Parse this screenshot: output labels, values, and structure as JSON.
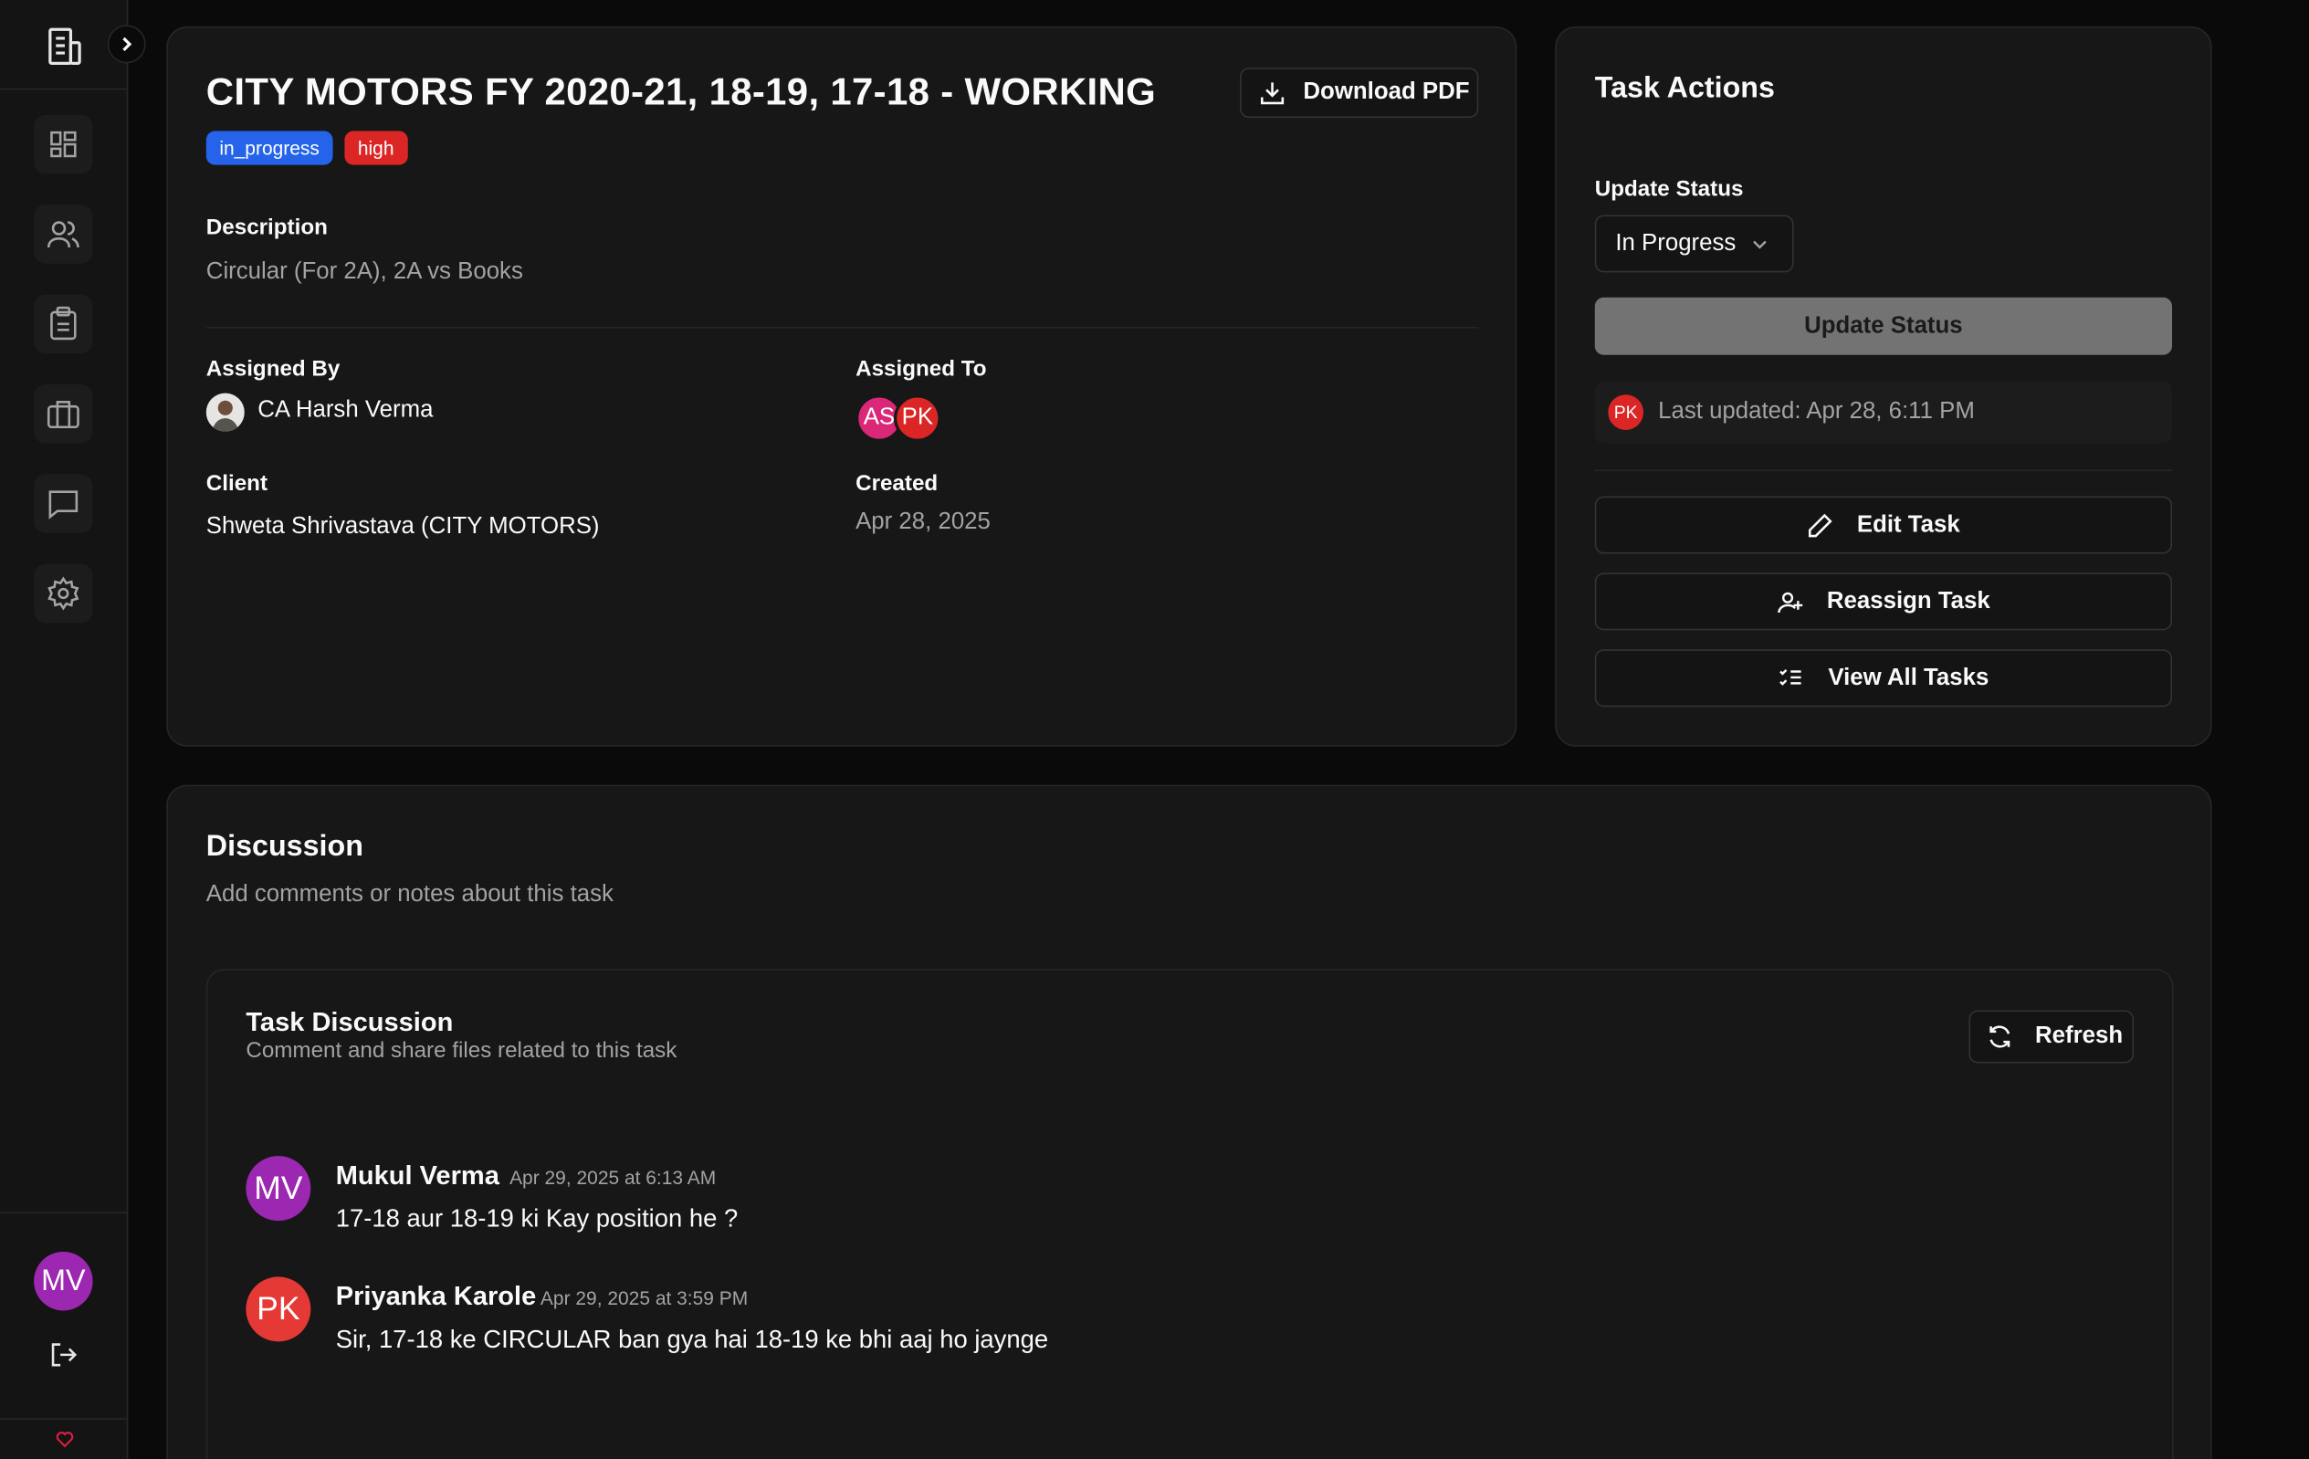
{
  "sidebar": {
    "nav": [
      "dashboard-icon",
      "users-icon",
      "clipboard-icon",
      "briefcase-icon",
      "message-icon",
      "settings-icon"
    ],
    "user_initials": "MV"
  },
  "task": {
    "title": "CITY MOTORS FY 2020-21, 18-19, 17-18 - WORKING",
    "status_badge": "in_progress",
    "priority_badge": "high",
    "download_label": "Download PDF",
    "description_label": "Description",
    "description": "Circular (For 2A), 2A vs Books",
    "assigned_by_label": "Assigned By",
    "assigned_by": "CA Harsh Verma",
    "assigned_to_label": "Assigned To",
    "assignees": [
      "AS",
      "PK"
    ],
    "client_label": "Client",
    "client": "Shweta Shrivastava (CITY MOTORS)",
    "created_label": "Created",
    "created": "Apr 28, 2025"
  },
  "actions": {
    "title": "Task Actions",
    "update_status_label": "Update Status",
    "status_value": "In Progress",
    "update_button": "Update Status",
    "last_updated_initials": "PK",
    "last_updated": "Last updated: Apr 28, 6:11 PM",
    "edit": "Edit Task",
    "reassign": "Reassign Task",
    "view_all": "View All Tasks"
  },
  "discussion": {
    "title": "Discussion",
    "subtitle": "Add comments or notes about this task",
    "inner_title": "Task Discussion",
    "inner_subtitle": "Comment and share files related to this task",
    "refresh": "Refresh",
    "messages": [
      {
        "initials": "MV",
        "name": "Mukul Verma",
        "time": "Apr 29, 2025 at 6:13 AM",
        "text": "17-18 aur 18-19 ki Kay position he ?",
        "color": "#9c27b0"
      },
      {
        "initials": "PK",
        "name": "Priyanka Karole",
        "time": "Apr 29, 2025 at 3:59 PM",
        "text": "Sir, 17-18 ke CIRCULAR ban gya hai 18-19 ke bhi aaj ho jaynge",
        "color": "#e53935"
      }
    ]
  },
  "colors": {
    "accent_blue": "#2563eb",
    "danger_red": "#dc2626",
    "purple": "#9c27b0"
  }
}
